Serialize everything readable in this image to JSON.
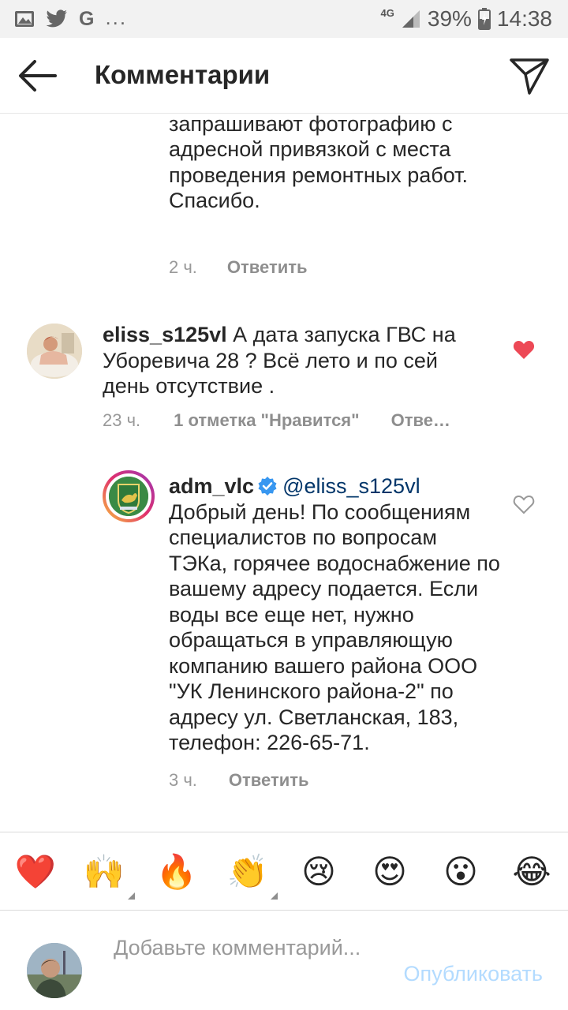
{
  "status_bar": {
    "network": "4G",
    "battery": "39%",
    "time": "14:38",
    "google_icon_letter": "G",
    "more_indicator": "...",
    "notification_icons": [
      "gallery-icon",
      "twitter-icon",
      "google-icon"
    ]
  },
  "header": {
    "title": "Комментарии",
    "back_icon": "arrow-left-icon",
    "share_icon": "paper-plane-icon"
  },
  "comments": [
    {
      "text": "информации специалисты запрашивают фотографию с адресной привязкой с места проведения ремонтных работ. Спасибо.",
      "time": "2 ч.",
      "reply_label": "Ответить"
    },
    {
      "username": "eliss_s125vl",
      "text": "А дата запуска ГВС на Уборевича 28 ? Всё лето и по сей день отсутствие .",
      "time": "23 ч.",
      "likes": "1 отметка \"Нравится\"",
      "reply_label": "Отве…",
      "liked": true
    },
    {
      "username": "adm_vlc",
      "verified": true,
      "mention": "@eliss_s125vl",
      "text": "Добрый день! По сообщениям специалистов по вопросам ТЭКа, горячее водоснабжение по вашему адресу подается. Если воды все еще нет, нужно обращаться в управляющую компанию вашего района ООО \"УК Ленинского района-2\" по адресу  ул. Светланская, 183, телефон: 226-65-71.",
      "time": "3 ч.",
      "reply_label": "Ответить",
      "liked": false
    }
  ],
  "emoji_bar": [
    {
      "char": "❤️",
      "name": "red-heart"
    },
    {
      "char": "🙌",
      "name": "raising-hands"
    },
    {
      "char": "🔥",
      "name": "fire"
    },
    {
      "char": "👏",
      "name": "clapping-hands"
    },
    {
      "char": "😢",
      "name": "crying-face"
    },
    {
      "char": "😍",
      "name": "heart-eyes"
    },
    {
      "char": "😮",
      "name": "surprised-face"
    },
    {
      "char": "😂",
      "name": "tears-of-joy"
    }
  ],
  "comment_input": {
    "placeholder": "Добавьте комментарий...",
    "publish_label": "Опубликовать"
  },
  "colors": {
    "like_red": "#ed4956",
    "verified_blue": "#3897f0",
    "mention_blue": "#003569",
    "publish_disabled": "#b3dbff",
    "meta_gray": "#999999"
  }
}
